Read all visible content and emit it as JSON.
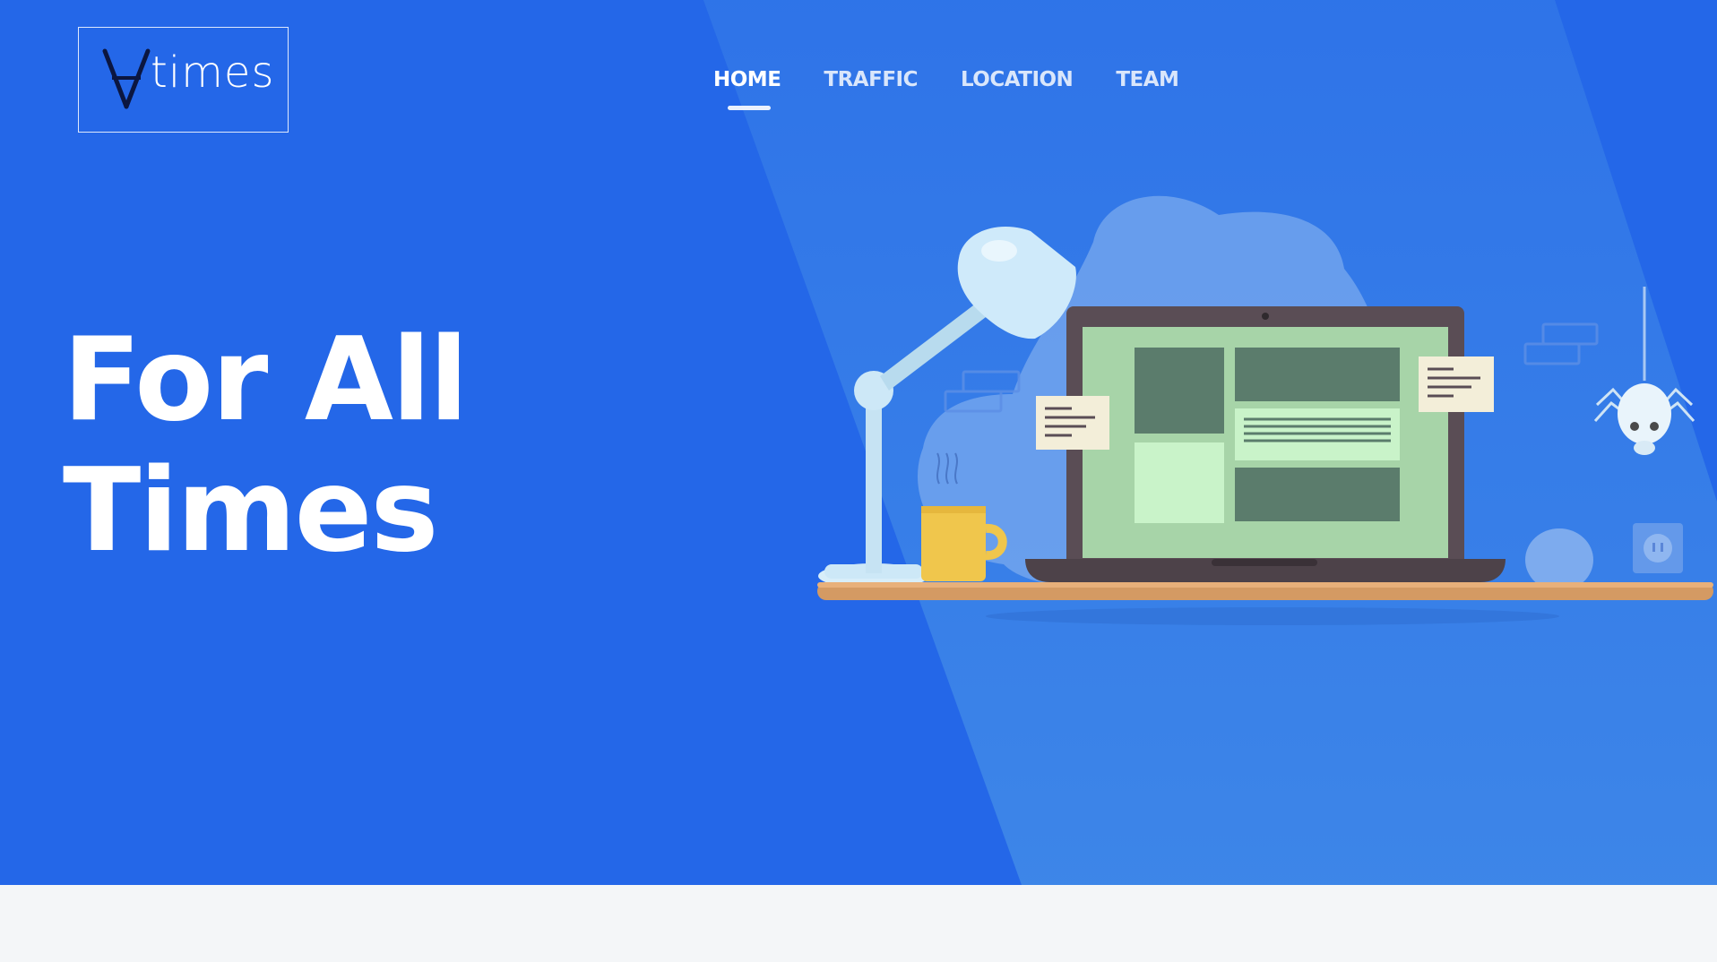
{
  "brand": {
    "name": "times",
    "logo_icon": "forall-icon"
  },
  "nav": {
    "items": [
      {
        "label": "HOME",
        "active": true
      },
      {
        "label": "TRAFFIC",
        "active": false
      },
      {
        "label": "LOCATION",
        "active": false
      },
      {
        "label": "TEAM",
        "active": false
      }
    ]
  },
  "hero": {
    "headline_line1": "For All",
    "headline_line2": "Times"
  },
  "colors": {
    "hero_bg": "#2467e8",
    "hero_band": "#3b86e6",
    "page_bg": "#f4f6f8"
  },
  "illustration": {
    "icons": [
      "desk-lamp-icon",
      "coffee-mug-icon",
      "laptop-icon",
      "sticky-note-icon",
      "spider-icon",
      "shelf-icon",
      "cloud-blob-icon",
      "power-outlet-icon"
    ]
  }
}
